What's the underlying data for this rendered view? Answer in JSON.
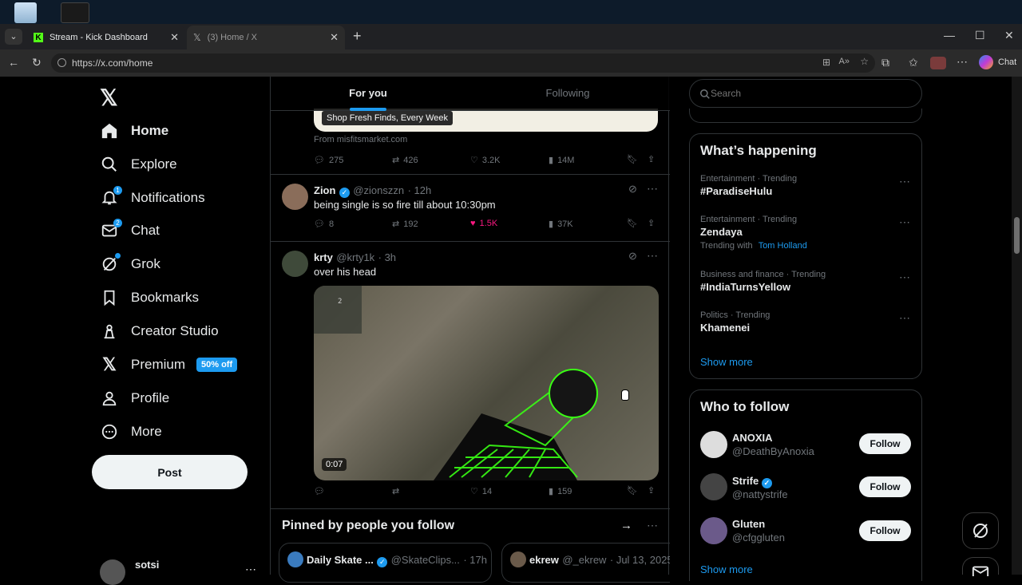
{
  "browser": {
    "tabs": [
      {
        "title": "Stream - Kick Dashboard"
      },
      {
        "title": "(3) Home / X"
      }
    ],
    "url": "https://x.com/home",
    "chat_label": "Chat"
  },
  "nav": {
    "items": [
      {
        "label": "Home",
        "icon": "home-icon"
      },
      {
        "label": "Explore",
        "icon": "search-icon"
      },
      {
        "label": "Notifications",
        "icon": "bell-icon",
        "badge": "1"
      },
      {
        "label": "Chat",
        "icon": "mail-icon",
        "badge": "2"
      },
      {
        "label": "Grok",
        "icon": "grok-icon"
      },
      {
        "label": "Bookmarks",
        "icon": "bookmark-icon"
      },
      {
        "label": "Creator Studio",
        "icon": "creator-studio-icon"
      },
      {
        "label": "Premium",
        "icon": "x-logo-icon",
        "promo": "50% off"
      },
      {
        "label": "Profile",
        "icon": "person-icon"
      },
      {
        "label": "More",
        "icon": "more-circle-icon"
      }
    ],
    "post_label": "Post",
    "account_name": "sotsi"
  },
  "feed": {
    "tabs": [
      "For you",
      "Following"
    ],
    "ad": {
      "banner_text": "Shop Fresh Finds, Every Week",
      "source": "From misfitsmarket.com",
      "replies": "275",
      "reposts": "426",
      "likes": "3.2K",
      "views": "14M"
    },
    "tweets": [
      {
        "name": "Zion",
        "handle": "@zionszzn",
        "time": "· 12h",
        "text": "being single is so fire till about 10:30pm",
        "replies": "8",
        "reposts": "192",
        "likes": "1.5K",
        "views": "37K",
        "liked": true
      },
      {
        "name": "krty",
        "handle": "@krty1k",
        "time": "· 3h",
        "text": "over his head",
        "video_duration": "0:07",
        "replies": "",
        "reposts": "",
        "likes": "14",
        "views": "159",
        "liked": false
      }
    ],
    "pinned": {
      "title": "Pinned by people you follow",
      "cards": [
        {
          "name": "Daily Skate ...",
          "handle": "@SkateClips...",
          "time": "· 17h"
        },
        {
          "name": "ekrew",
          "handle": "@_ekrew",
          "time": "· Jul 13, 2025"
        }
      ]
    }
  },
  "sidebar": {
    "search_placeholder": "Search",
    "happening_title": "What’s happening",
    "trends": [
      {
        "category": "Entertainment · Trending",
        "name": "#ParadiseHulu"
      },
      {
        "category": "Entertainment · Trending",
        "name": "Zendaya",
        "with_label": "Trending with",
        "with_link": "Tom Holland"
      },
      {
        "category": "Business and finance · Trending",
        "name": "#IndiaTurnsYellow"
      },
      {
        "category": "Politics · Trending",
        "name": "Khamenei"
      }
    ],
    "show_more": "Show more",
    "wtf_title": "Who to follow",
    "follow_label": "Follow",
    "suggestions": [
      {
        "name": "ANOXIA",
        "handle": "@DeathByAnoxia",
        "verified": false
      },
      {
        "name": "Strife",
        "handle": "@nattystrife",
        "verified": true
      },
      {
        "name": "Gluten",
        "handle": "@cfggluten",
        "verified": false
      }
    ]
  },
  "colors": {
    "accent": "#1d9bf0",
    "like": "#f91880",
    "border": "#2f3336",
    "muted": "#71767b"
  }
}
